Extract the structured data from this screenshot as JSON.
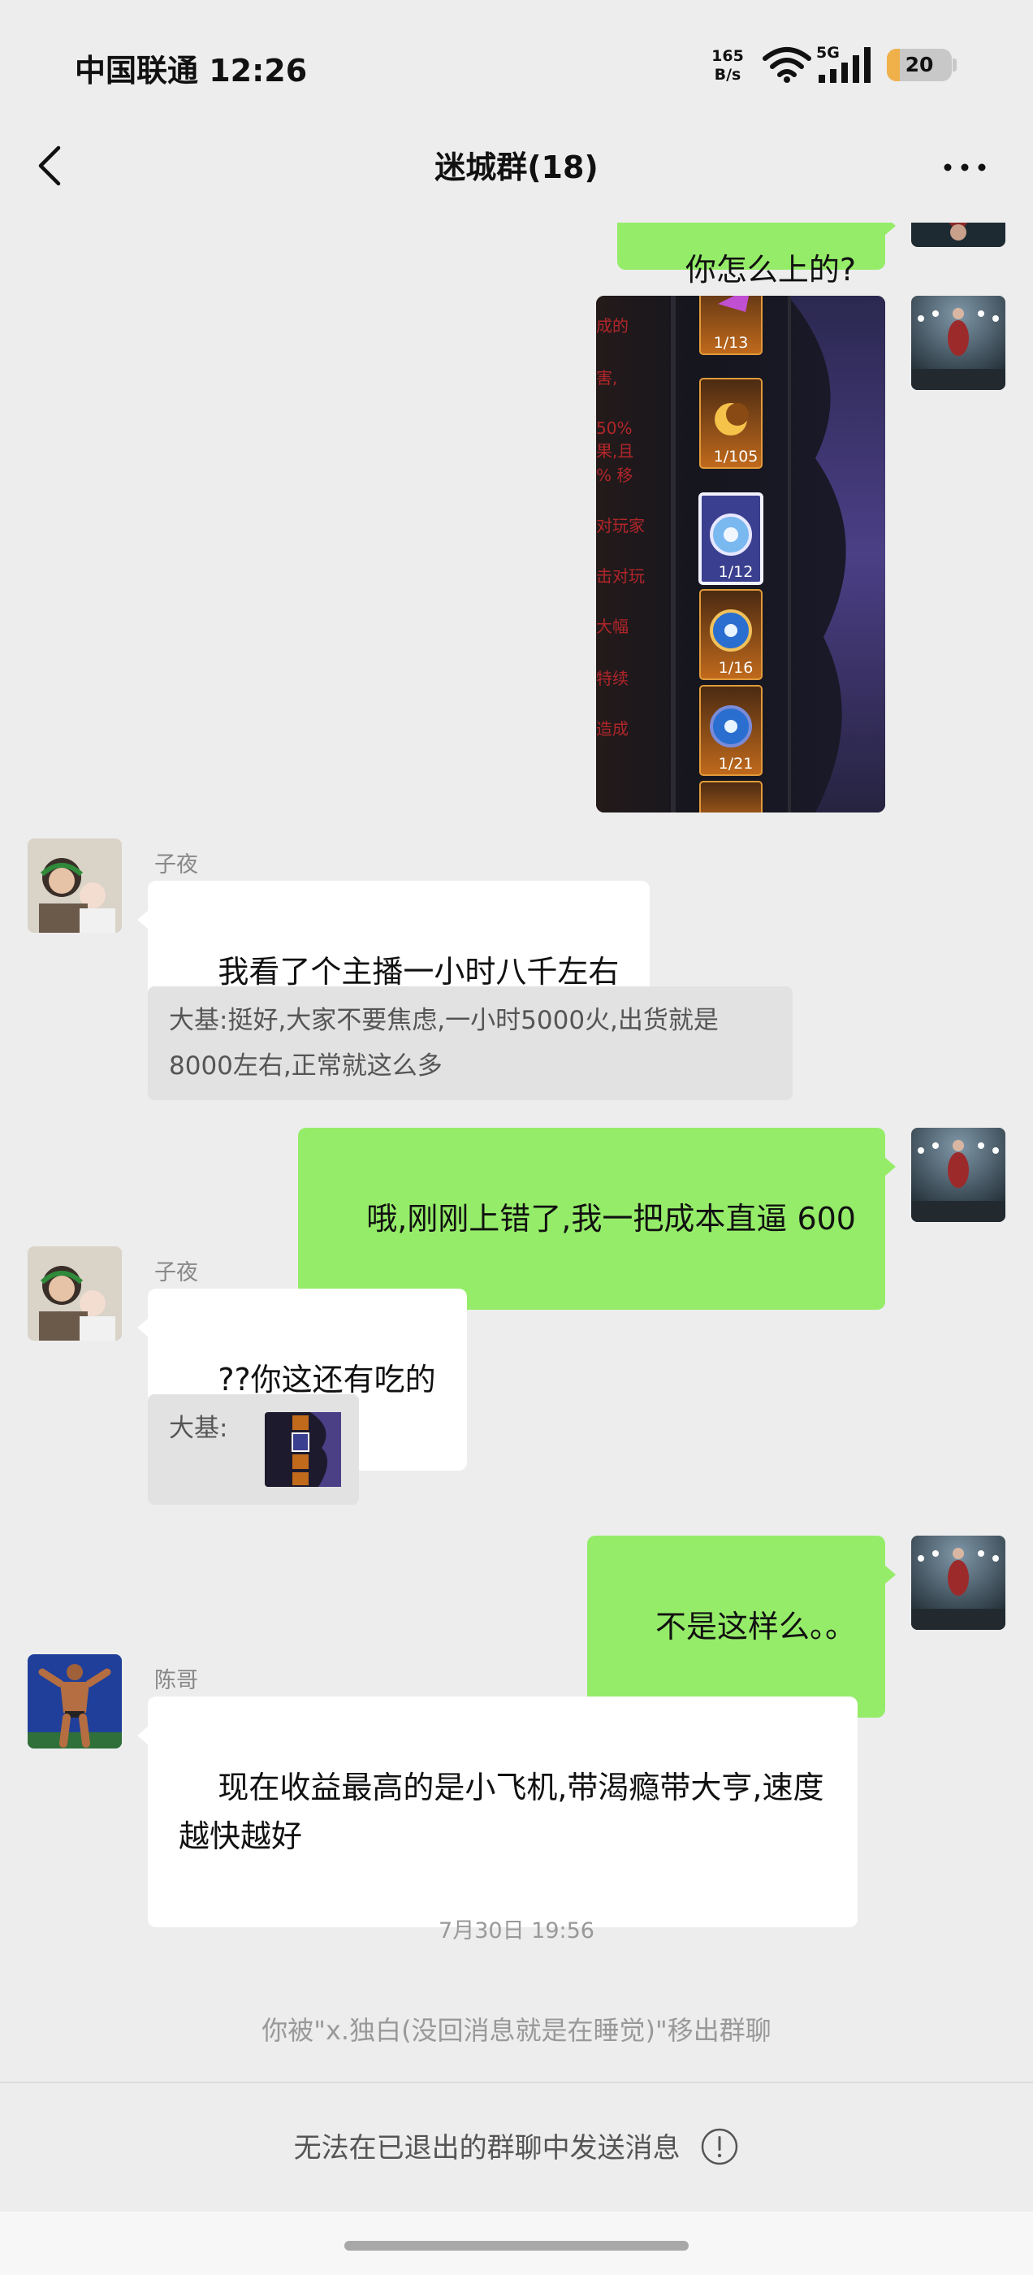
{
  "status_bar": {
    "carrier_time": "中国联通 12:26",
    "net_speed_value": "165",
    "net_speed_unit": "B/s",
    "network_type": "5G",
    "battery_level": "20",
    "battery_fraction": 0.2,
    "battery_color": "#f0b14a"
  },
  "nav": {
    "back_icon": "chevron-left-icon",
    "title": "迷城群(18)",
    "more_icon": "more-horizontal-icon"
  },
  "messages": {
    "m0_text": "你怎么上的?",
    "m1_image": "game-item-list-screenshot",
    "m1_items": [
      "1/13",
      "1/105",
      "1/12",
      "1/16",
      "1/21"
    ],
    "m1_side_text": [
      "成的",
      "害,",
      "50%",
      "果,且",
      "% 移",
      "对玩家",
      "击对玩",
      "大幅",
      "特续",
      "造成"
    ],
    "m2_sender": "子夜",
    "m2_text": "我看了个主播一小时八千左右",
    "m2_quote": "大基:挺好,大家不要焦虑,一小时5000火,出货就是8000左右,正常就这么多",
    "m3_text": "哦,刚刚上错了,我一把成本直逼 600",
    "m4_sender": "子夜",
    "m4_text": "??你这还有吃的",
    "m4_quote_label": "大基:",
    "m5_text": "不是这样么。。",
    "m6_sender": "陈哥",
    "m6_text": "现在收益最高的是小飞机,带渴瘾带大亨,速度越快越好",
    "time_separator": "7月30日 19:56",
    "system_notice": "你被\"x.独白(没回消息就是在睡觉)\"移出群聊"
  },
  "bottom": {
    "text": "无法在已退出的群聊中发送消息",
    "info_icon": "info-circle-icon"
  },
  "colors": {
    "background": "#ededed",
    "bubble_outgoing": "#95ec69",
    "bubble_incoming": "#ffffff",
    "quote_background": "#e2e2e2"
  }
}
